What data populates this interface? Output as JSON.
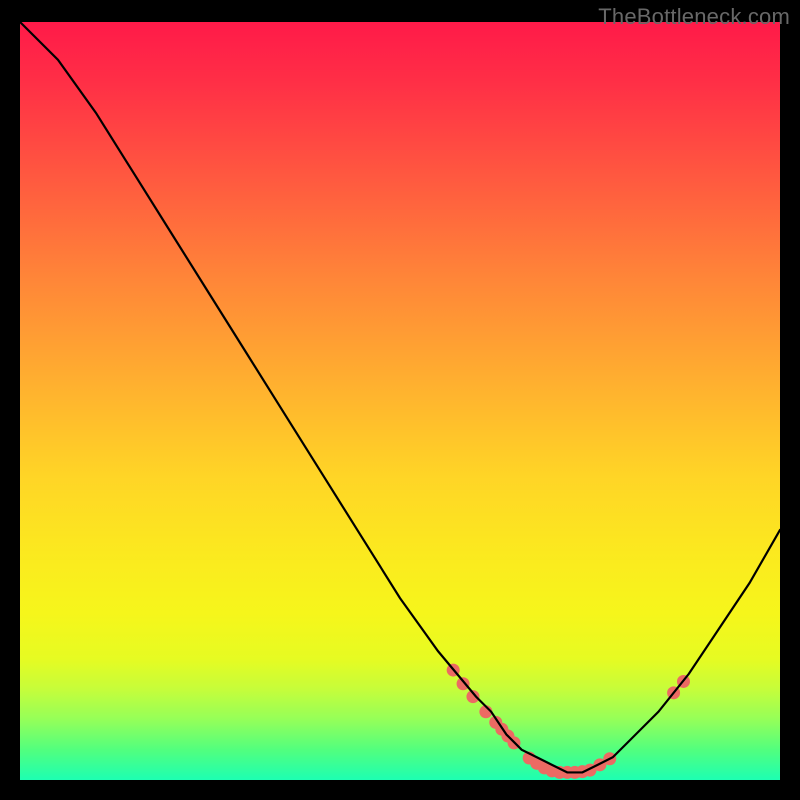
{
  "watermark": "TheBottleneck.com",
  "chart_data": {
    "type": "line",
    "title": "",
    "xlabel": "",
    "ylabel": "",
    "xlim": [
      0,
      100
    ],
    "ylim": [
      0,
      100
    ],
    "grid": false,
    "legend": false,
    "series": [
      {
        "name": "curve",
        "x": [
          0,
          5,
          10,
          15,
          20,
          25,
          30,
          35,
          40,
          45,
          50,
          55,
          60,
          62,
          64,
          66,
          68,
          70,
          72,
          74,
          76,
          78,
          80,
          84,
          88,
          92,
          96,
          100
        ],
        "y": [
          100,
          95,
          88,
          80,
          72,
          64,
          56,
          48,
          40,
          32,
          24,
          17,
          11,
          9,
          6,
          4,
          3,
          2,
          1,
          1,
          2,
          3,
          5,
          9,
          14,
          20,
          26,
          33
        ],
        "color": "#000000",
        "linewidth": 2.2
      }
    ],
    "markers": [
      {
        "x": 57.0,
        "y": 14.5,
        "r": 6.5,
        "color": "#ec6a63"
      },
      {
        "x": 58.3,
        "y": 12.7,
        "r": 6.5,
        "color": "#ec6a63"
      },
      {
        "x": 59.6,
        "y": 11.0,
        "r": 6.5,
        "color": "#ec6a63"
      },
      {
        "x": 61.3,
        "y": 9.0,
        "r": 6.5,
        "color": "#ec6a63"
      },
      {
        "x": 62.6,
        "y": 7.6,
        "r": 6.5,
        "color": "#ec6a63"
      },
      {
        "x": 63.4,
        "y": 6.7,
        "r": 6.5,
        "color": "#ec6a63"
      },
      {
        "x": 64.2,
        "y": 5.8,
        "r": 6.5,
        "color": "#ec6a63"
      },
      {
        "x": 65.0,
        "y": 4.9,
        "r": 6.5,
        "color": "#ec6a63"
      },
      {
        "x": 67.0,
        "y": 2.9,
        "r": 6.5,
        "color": "#ec6a63"
      },
      {
        "x": 68.0,
        "y": 2.2,
        "r": 6.5,
        "color": "#ec6a63"
      },
      {
        "x": 69.0,
        "y": 1.6,
        "r": 6.5,
        "color": "#ec6a63"
      },
      {
        "x": 70.0,
        "y": 1.2,
        "r": 6.5,
        "color": "#ec6a63"
      },
      {
        "x": 71.0,
        "y": 1.0,
        "r": 6.5,
        "color": "#ec6a63"
      },
      {
        "x": 72.0,
        "y": 1.0,
        "r": 6.5,
        "color": "#ec6a63"
      },
      {
        "x": 73.0,
        "y": 1.0,
        "r": 6.5,
        "color": "#ec6a63"
      },
      {
        "x": 74.0,
        "y": 1.1,
        "r": 6.5,
        "color": "#ec6a63"
      },
      {
        "x": 75.0,
        "y": 1.3,
        "r": 6.5,
        "color": "#ec6a63"
      },
      {
        "x": 76.3,
        "y": 2.0,
        "r": 6.5,
        "color": "#ec6a63"
      },
      {
        "x": 77.6,
        "y": 2.8,
        "r": 6.5,
        "color": "#ec6a63"
      },
      {
        "x": 86.0,
        "y": 11.5,
        "r": 6.5,
        "color": "#ec6a63"
      },
      {
        "x": 87.3,
        "y": 13.0,
        "r": 6.5,
        "color": "#ec6a63"
      }
    ],
    "gradient_colors": {
      "top": "#ff1a49",
      "mid": "#fbe91f",
      "bottom": "#1dffb2"
    }
  }
}
